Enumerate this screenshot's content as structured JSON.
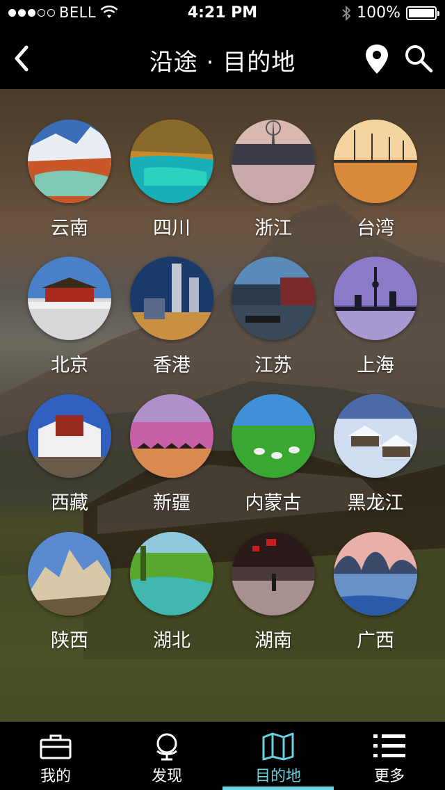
{
  "status_bar": {
    "carrier": "BELL",
    "time": "4:21 PM",
    "battery_percent": "100%",
    "signal_bars_filled": 3,
    "signal_bars_total": 5
  },
  "nav": {
    "title": "沿途 · 目的地",
    "back_icon": "chevron-left-icon",
    "location_icon": "map-pin-icon",
    "search_icon": "search-icon"
  },
  "destinations": [
    {
      "label": "云南"
    },
    {
      "label": "四川"
    },
    {
      "label": "浙江"
    },
    {
      "label": "台湾"
    },
    {
      "label": "北京"
    },
    {
      "label": "香港"
    },
    {
      "label": "江苏"
    },
    {
      "label": "上海"
    },
    {
      "label": "西藏"
    },
    {
      "label": "新疆"
    },
    {
      "label": "内蒙古"
    },
    {
      "label": "黑龙江"
    },
    {
      "label": "陕西"
    },
    {
      "label": "湖北"
    },
    {
      "label": "湖南"
    },
    {
      "label": "广西"
    }
  ],
  "tabs": [
    {
      "label": "我的",
      "icon": "briefcase-icon",
      "active": false
    },
    {
      "label": "发现",
      "icon": "globe-icon",
      "active": false
    },
    {
      "label": "目的地",
      "icon": "map-icon",
      "active": true
    },
    {
      "label": "更多",
      "icon": "list-icon",
      "active": false
    }
  ],
  "colors": {
    "accent": "#6ad3df",
    "bar_background": "#000000"
  }
}
